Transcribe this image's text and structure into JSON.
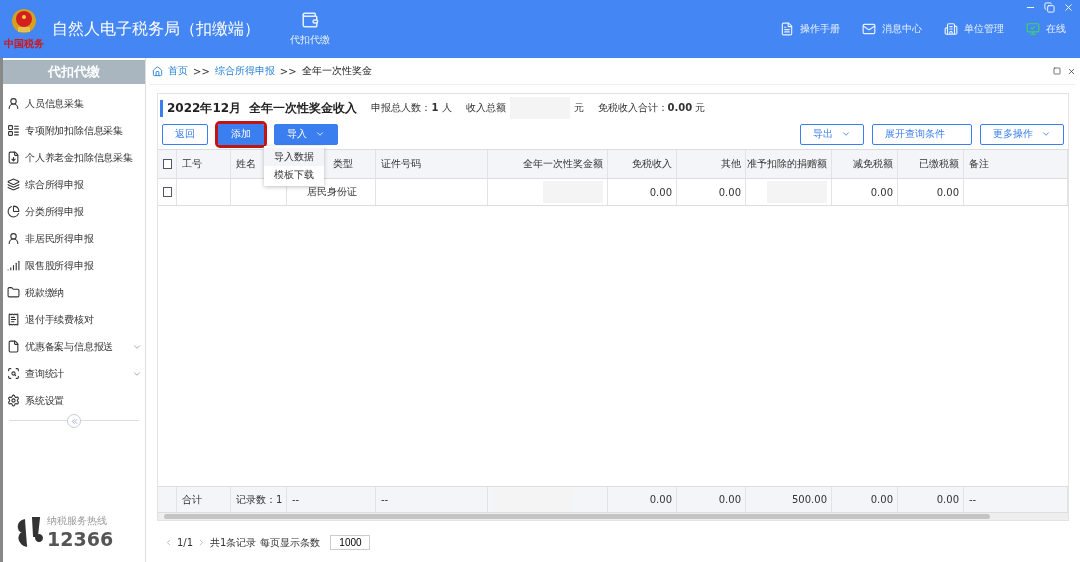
{
  "app": {
    "title": "自然人电子税务局（扣缴端）",
    "logo_caption": "中国税务",
    "module": {
      "label": "代扣代缴",
      "selected": true
    },
    "header_links": [
      {
        "kind": "manual",
        "label": "操作手册"
      },
      {
        "kind": "message",
        "label": "消息中心"
      },
      {
        "kind": "unit",
        "label": "单位管理"
      },
      {
        "kind": "online",
        "label": "在线"
      }
    ]
  },
  "sidebar": {
    "title": "代扣代缴",
    "items": [
      {
        "kind": "person",
        "label": "人员信息采集",
        "group": false
      },
      {
        "kind": "list",
        "label": "专项附加扣除信息采集",
        "group": false
      },
      {
        "kind": "pension",
        "label": "个人养老金扣除信息采集",
        "group": false
      },
      {
        "kind": "layers",
        "label": "综合所得申报",
        "group": false
      },
      {
        "kind": "pie",
        "label": "分类所得申报",
        "group": false
      },
      {
        "kind": "person",
        "label": "非居民所得申报",
        "group": false
      },
      {
        "kind": "bars",
        "label": "限售股所得申报",
        "group": false
      },
      {
        "kind": "folder",
        "label": "税款缴纳",
        "group": false
      },
      {
        "kind": "receipt",
        "label": "退付手续费核对",
        "group": false
      },
      {
        "kind": "file",
        "label": "优惠备案与信息报送",
        "group": true
      },
      {
        "kind": "search",
        "label": "查询统计",
        "group": true
      },
      {
        "kind": "settings",
        "label": "系统设置",
        "group": false
      }
    ],
    "hotline": {
      "label": "纳税服务热线",
      "number": "12366"
    }
  },
  "breadcrumb": [
    {
      "label": "首页",
      "link": true
    },
    {
      "label": "综合所得申报",
      "link": true
    },
    {
      "label": "全年一次性奖金",
      "link": false
    }
  ],
  "breadcrumb_separator": ">>",
  "page": {
    "title": "2022年12月  全年一次性奖金收入",
    "summary": [
      {
        "text": "申报总人数：**1** 人",
        "redacted": false
      },
      {
        "text": "收入总额",
        "redacted": true,
        "unit": "元"
      },
      {
        "text": "免税收入合计：**0.00** 元",
        "redacted": false
      }
    ],
    "left_buttons": [
      {
        "label": "返回",
        "kind": "outline",
        "annotated": false,
        "dropdown": false
      },
      {
        "label": "添加",
        "kind": "primary",
        "annotated": true,
        "dropdown": false
      },
      {
        "label": "导入",
        "kind": "primary",
        "annotated": false,
        "dropdown": true
      }
    ],
    "import_menu": [
      {
        "label": "导入数据",
        "highlighted": true
      },
      {
        "label": "模板下载",
        "highlighted": false
      }
    ],
    "right_buttons": [
      {
        "label": "导出",
        "dropdown": true
      },
      {
        "label": "展开查询条件",
        "dropdown": false
      },
      {
        "label": "更多操作",
        "dropdown": true
      }
    ]
  },
  "table": {
    "select_all_checked": false,
    "columns": [
      {
        "label": "工号",
        "kind": "text"
      },
      {
        "label": "姓名",
        "kind": "text"
      },
      {
        "label": "类型",
        "kind": "text"
      },
      {
        "label": "证件号码",
        "kind": "text"
      },
      {
        "label": "全年一次性奖金额",
        "kind": "amount"
      },
      {
        "label": "免税收入",
        "kind": "amount"
      },
      {
        "label": "其他",
        "kind": "amount"
      },
      {
        "label": "准予扣除的捐赠额",
        "kind": "amount"
      },
      {
        "label": "减免税额",
        "kind": "amount"
      },
      {
        "label": "已缴税额",
        "kind": "amount"
      },
      {
        "label": "备注",
        "kind": "text"
      }
    ],
    "rows": [
      {
        "checked": false,
        "cells": [
          {},
          {},
          {
            "text": "居民身份证"
          },
          {},
          {
            "redacted": true
          },
          {
            "text": "0.00"
          },
          {
            "text": "0.00"
          },
          {
            "redacted": true
          },
          {
            "text": "0.00"
          },
          {
            "text": "0.00"
          },
          {}
        ]
      }
    ],
    "totals": [
      {
        "text": "合计"
      },
      {
        "text": "记录数：1"
      },
      {
        "text": "--"
      },
      {
        "text": "--"
      },
      {
        "redacted": true
      },
      {
        "text": "0.00"
      },
      {
        "text": "0.00"
      },
      {
        "text": "500.00"
      },
      {
        "text": "0.00"
      },
      {
        "text": "0.00"
      },
      {
        "text": "--"
      }
    ]
  },
  "pager": {
    "pages": "1/1",
    "records": "共1条记录",
    "page_size_label": "每页显示条数",
    "page_size": "1000"
  }
}
